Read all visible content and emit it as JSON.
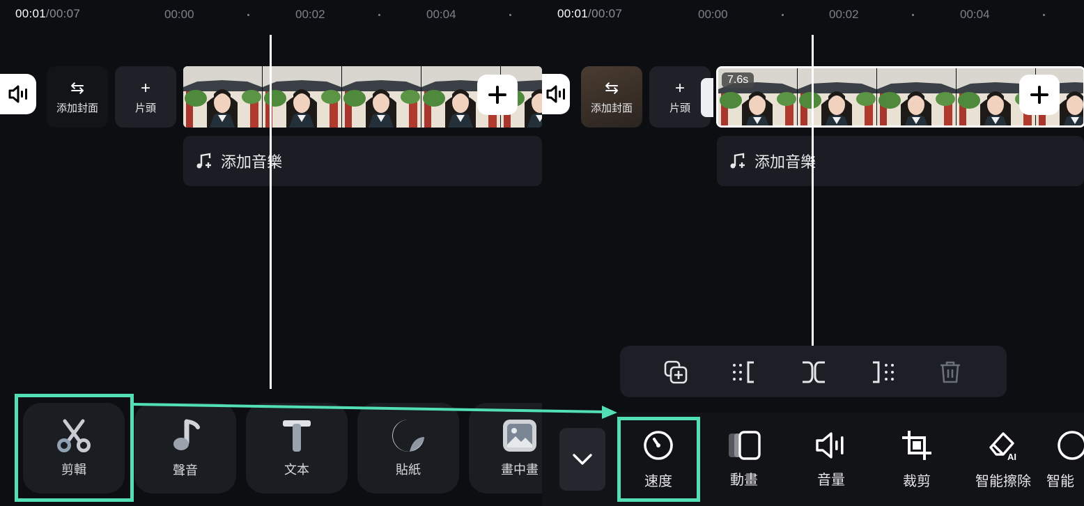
{
  "accent_color": "#52dfb5",
  "left": {
    "timecode": {
      "current": "00:01",
      "total": "/00:07"
    },
    "ruler": [
      "00:00",
      "00:02",
      "00:04"
    ],
    "cover_label": "添加封面",
    "intro_label": "片頭",
    "music_label": "添加音樂",
    "toolbar": [
      {
        "label": "剪輯",
        "icon": "scissors-icon"
      },
      {
        "label": "聲音",
        "icon": "music-note-icon"
      },
      {
        "label": "文本",
        "icon": "text-icon"
      },
      {
        "label": "貼紙",
        "icon": "sticker-icon"
      },
      {
        "label": "畫中畫",
        "icon": "picture-in-picture-icon"
      }
    ]
  },
  "right": {
    "timecode": {
      "current": "00:01",
      "total": "/00:07"
    },
    "ruler": [
      "00:00",
      "00:02",
      "00:04"
    ],
    "cover_label": "添加封面",
    "intro_label": "片頭",
    "clip_duration": "7.6s",
    "music_label": "添加音樂",
    "clip_actions": [
      "copy-icon",
      "split-left-icon",
      "split-icon",
      "split-right-icon",
      "delete-icon"
    ],
    "toolbar": [
      {
        "label": "速度",
        "icon": "speed-icon"
      },
      {
        "label": "動畫",
        "icon": "animation-icon"
      },
      {
        "label": "音量",
        "icon": "volume-icon"
      },
      {
        "label": "裁剪",
        "icon": "crop-icon"
      },
      {
        "label": "智能擦除",
        "icon": "ai-eraser-icon"
      },
      {
        "label": "智能",
        "icon": "ai-icon"
      }
    ]
  }
}
